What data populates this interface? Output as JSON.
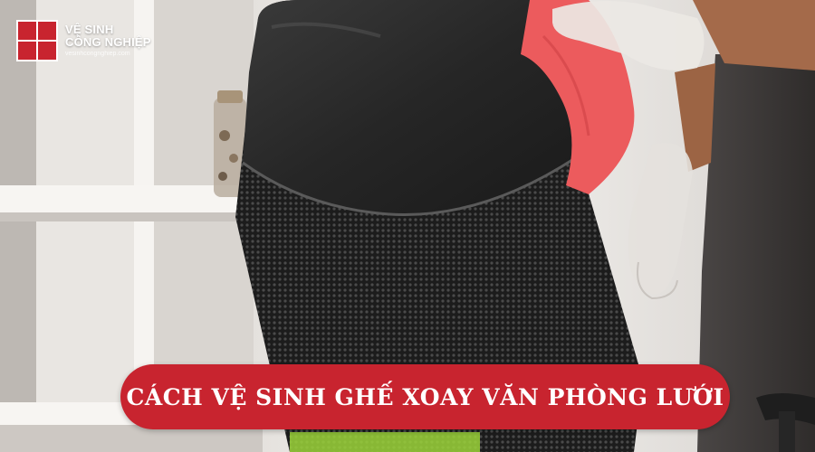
{
  "logo": {
    "line1": "VỆ SINH",
    "line2": "CÔNG NGHIỆP",
    "url": "vesinhcongnghiep.com"
  },
  "banner": {
    "title": "CÁCH VỆ SINH GHẾ XOAY VĂN PHÒNG LƯỚI"
  },
  "colors": {
    "brand_red": "#c8242f",
    "cloth_pink": "#ec5b5d"
  }
}
